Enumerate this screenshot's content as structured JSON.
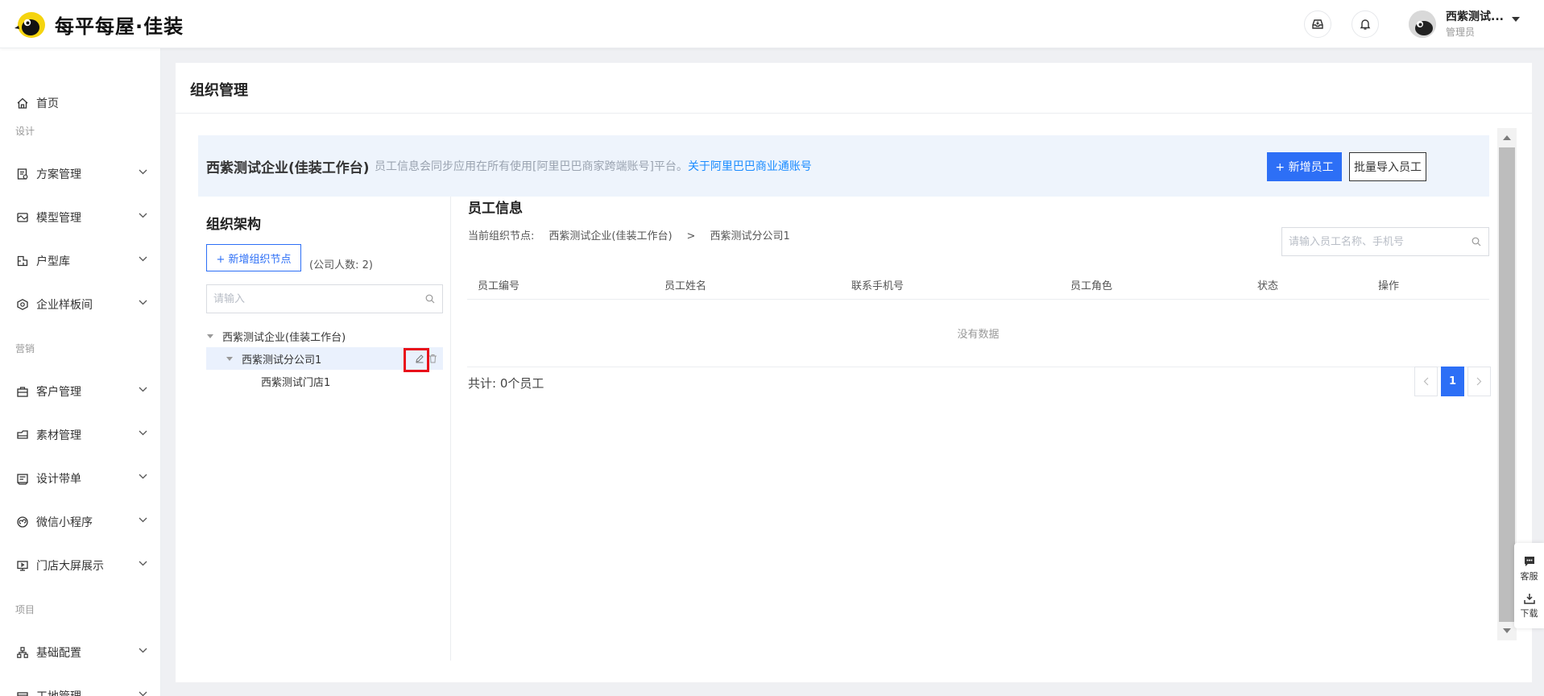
{
  "brand": {
    "name": "每平每屋·佳装",
    "accent": "#2d6ff6"
  },
  "header": {
    "user_name": "西紫测试...",
    "user_role": "管理员",
    "icons": [
      "inbox-icon",
      "bell-icon"
    ]
  },
  "sidebar": {
    "home": {
      "label": "首页",
      "icon": "home-icon"
    },
    "groups": {
      "design": "设计",
      "marketing": "营销",
      "project": "项目"
    },
    "items": [
      {
        "label": "方案管理",
        "icon": "plan-icon"
      },
      {
        "label": "模型管理",
        "icon": "model-icon"
      },
      {
        "label": "户型库",
        "icon": "floorplan-icon"
      },
      {
        "label": "企业样板间",
        "icon": "showroom-icon"
      },
      {
        "label": "客户管理",
        "icon": "customer-icon"
      },
      {
        "label": "素材管理",
        "icon": "material-icon"
      },
      {
        "label": "设计带单",
        "icon": "order-icon"
      },
      {
        "label": "微信小程序",
        "icon": "miniapp-icon"
      },
      {
        "label": "门店大屏展示",
        "icon": "screen-icon"
      },
      {
        "label": "基础配置",
        "icon": "config-icon"
      },
      {
        "label": "工地管理",
        "icon": "site-icon"
      }
    ]
  },
  "page": {
    "title": "组织管理"
  },
  "banner": {
    "company": "西紫测试企业(佳装工作台)",
    "desc": "员工信息会同步应用在所有使用[阿里巴巴商家跨端账号]平台。",
    "link": "关于阿里巴巴商业通账号",
    "add_employee": "+ 新增员工",
    "batch_import": "批量导入员工"
  },
  "org": {
    "title": "组织架构",
    "add_node": "+ 新增组织节点",
    "count": "(公司人数: 2)",
    "search_placeholder": "请输入",
    "tree": {
      "root": "西紫测试企业(佳装工作台)",
      "branch": "西紫测试分公司1",
      "leaf": "西紫测试门店1"
    }
  },
  "employees": {
    "title": "员工信息",
    "crumb_label": "当前组织节点:",
    "crumb_root": "西紫测试企业(佳装工作台)",
    "crumb_sep": ">",
    "crumb_current": "西紫测试分公司1",
    "search_placeholder": "请输入员工名称、手机号",
    "columns": [
      "员工编号",
      "员工姓名",
      "联系手机号",
      "员工角色",
      "状态",
      "操作"
    ],
    "empty": "没有数据",
    "total": "共计: 0个员工",
    "page": "1"
  },
  "float": {
    "service": "客服",
    "download": "下载"
  }
}
